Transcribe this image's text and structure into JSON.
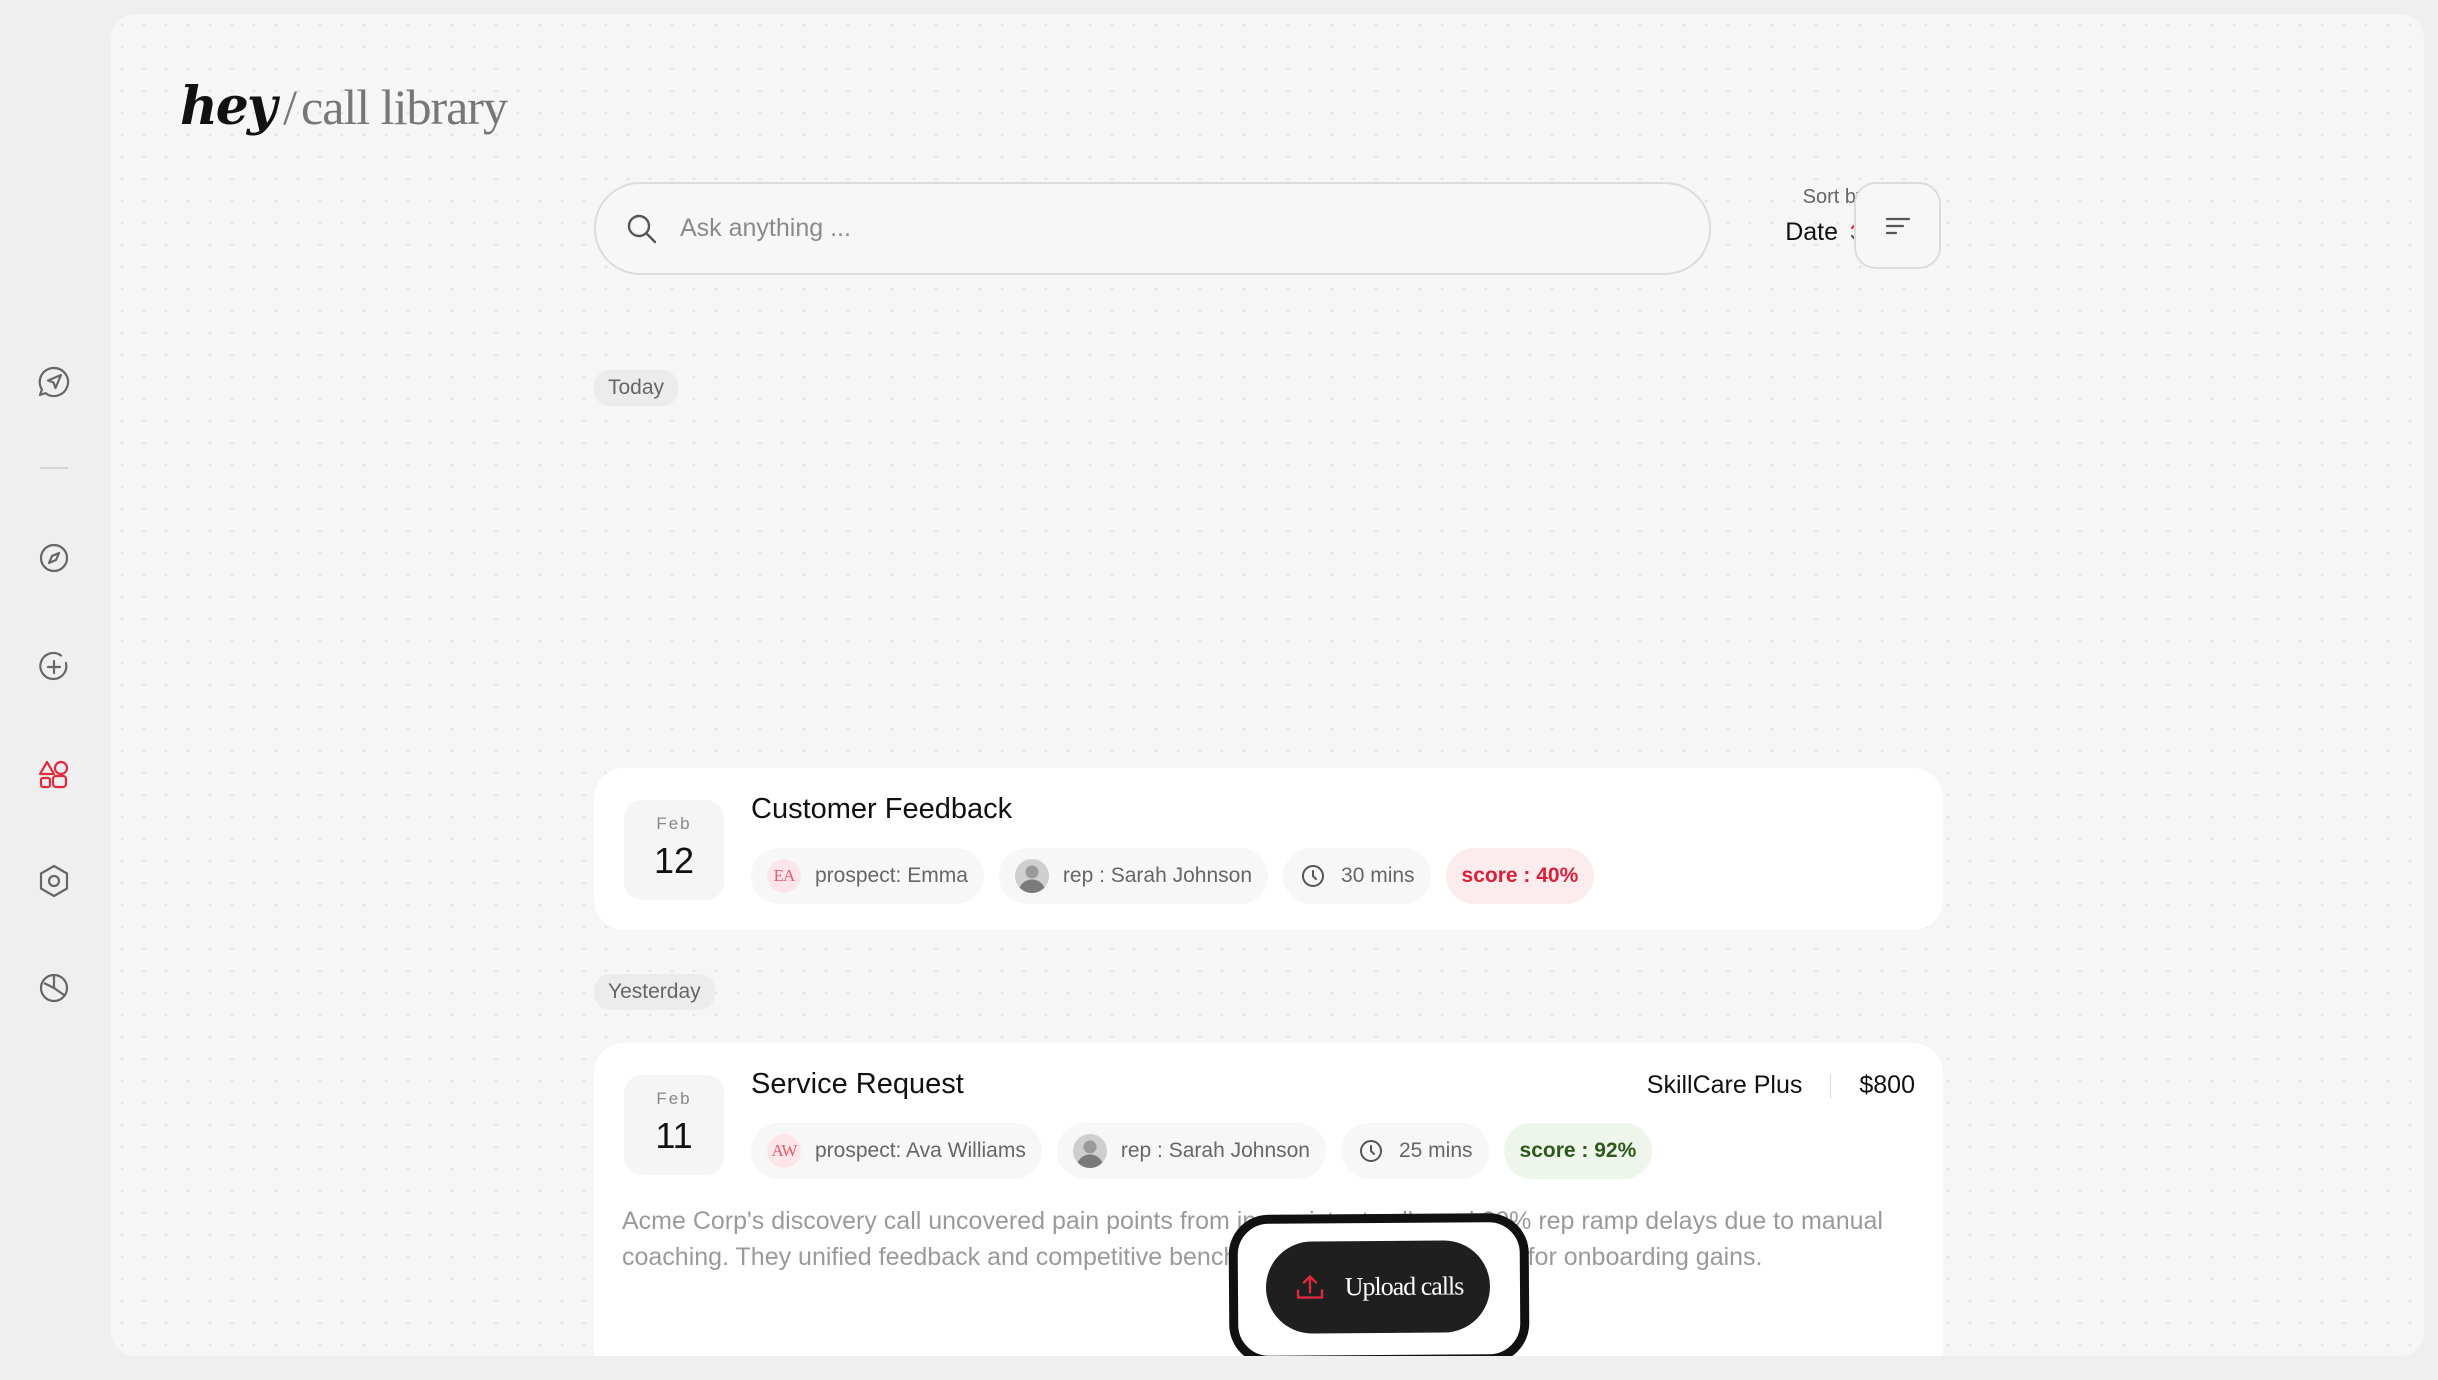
{
  "brand": {
    "name": "hey",
    "separator": "/",
    "section": "call library"
  },
  "nav": {
    "items": [
      {
        "icon": "send-chat-icon",
        "active": false
      },
      {
        "icon": "compass-icon",
        "active": false
      },
      {
        "icon": "add-circle-icon",
        "active": false
      },
      {
        "icon": "shapes-icon",
        "active": true
      },
      {
        "icon": "settings-hex-icon",
        "active": false
      },
      {
        "icon": "pie-chart-icon",
        "active": false
      }
    ],
    "active_color": "#e0293c"
  },
  "search": {
    "placeholder": "Ask anything ...",
    "value": ""
  },
  "sort": {
    "label": "Sort by",
    "value": "Date"
  },
  "sections": [
    {
      "label": "Today",
      "calls": [
        {
          "month": "Feb",
          "day": "12",
          "title": "Customer Feedback",
          "prospect_initials": "EA",
          "prospect": "prospect: Emma",
          "rep": "rep : Sarah Johnson",
          "duration": "30 mins",
          "score": "score : 40%"
        }
      ]
    },
    {
      "label": "Yesterday",
      "calls": [
        {
          "month": "Feb",
          "day": "11",
          "title": "Service Request",
          "product": "SkillCare Plus",
          "amount": "$800",
          "prospect_initials": "AW",
          "prospect": "prospect: Ava Williams",
          "rep": "rep : Sarah Johnson",
          "duration": "25 mins",
          "score": "score : 92%",
          "summary": "Acme Corp's discovery call uncovered pain points from inconsistent calls and 20% rep ramp delays due to manual coaching. They unified feedback and competitive benchmarking, with Q1 urgency for onboarding gains."
        }
      ]
    }
  ],
  "upload": {
    "label": "Upload calls",
    "icon": "upload-icon",
    "accent": "#e0293c"
  }
}
